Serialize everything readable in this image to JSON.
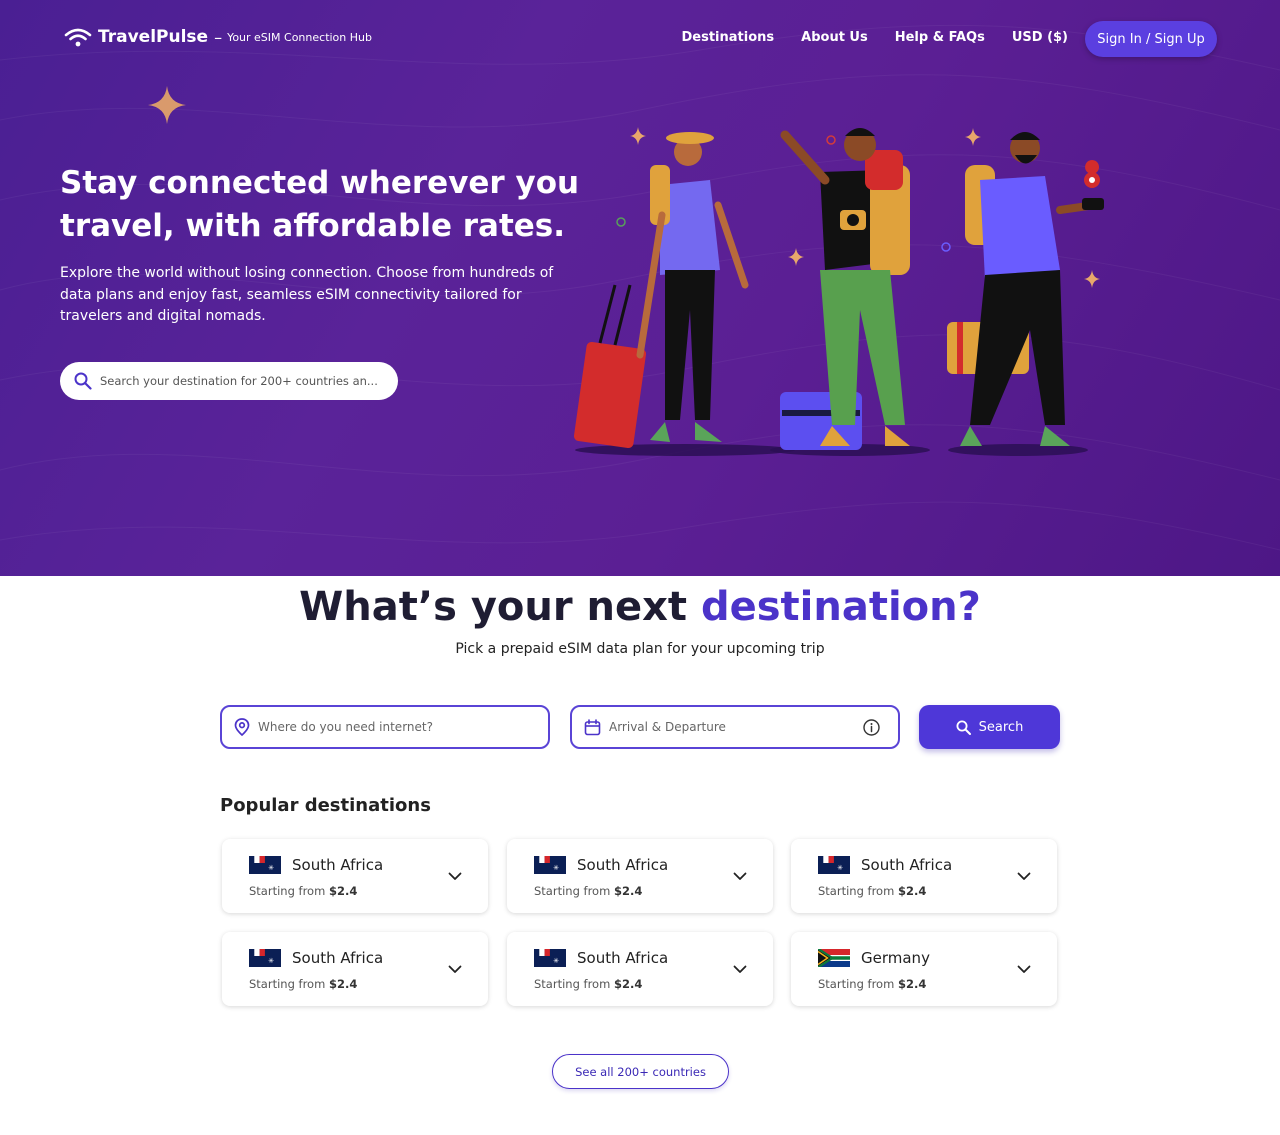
{
  "colors": {
    "hero_bg": "#561f96",
    "accent": "#4b33c9",
    "button": "#4e37d8"
  },
  "header": {
    "brand": "TravelPulse",
    "dash": "–",
    "tagline": "Your eSIM Connection Hub",
    "nav": [
      "Destinations",
      "About Us",
      "Help & FAQs",
      "USD ($)"
    ],
    "signin": "Sign In / Sign Up"
  },
  "hero": {
    "title": "Stay connected wherever you travel, with affordable rates.",
    "subtitle": "Explore the world without losing connection. Choose from hundreds of data plans and enjoy fast, seamless eSIM connectivity tailored for travelers and digital nomads.",
    "search_placeholder": "Search your destination for 200+ countries an..."
  },
  "main": {
    "title_part1": "What’s your next ",
    "title_accent": "destination?",
    "subtitle": "Pick a prepaid eSIM data plan for your upcoming trip",
    "where_placeholder": "Where do you need internet?",
    "date_placeholder": "Arrival & Departure",
    "search_label": "Search",
    "popular_title": "Popular destinations",
    "destinations": [
      {
        "country": "South Africa",
        "price_prefix": "Starting from ",
        "price": "$2.4",
        "flag": "french-southern-territories-flag"
      },
      {
        "country": "South Africa",
        "price_prefix": "Starting from ",
        "price": "$2.4",
        "flag": "french-southern-territories-flag"
      },
      {
        "country": "South Africa",
        "price_prefix": "Starting from ",
        "price": "$2.4",
        "flag": "french-southern-territories-flag"
      },
      {
        "country": "South Africa",
        "price_prefix": "Starting from ",
        "price": "$2.4",
        "flag": "french-southern-territories-flag"
      },
      {
        "country": "South Africa",
        "price_prefix": "Starting from ",
        "price": "$2.4",
        "flag": "french-southern-territories-flag"
      },
      {
        "country": "Germany",
        "price_prefix": "Starting from ",
        "price": "$2.4",
        "flag": "south-africa-flag"
      }
    ],
    "see_all": "See all 200+ countries"
  }
}
